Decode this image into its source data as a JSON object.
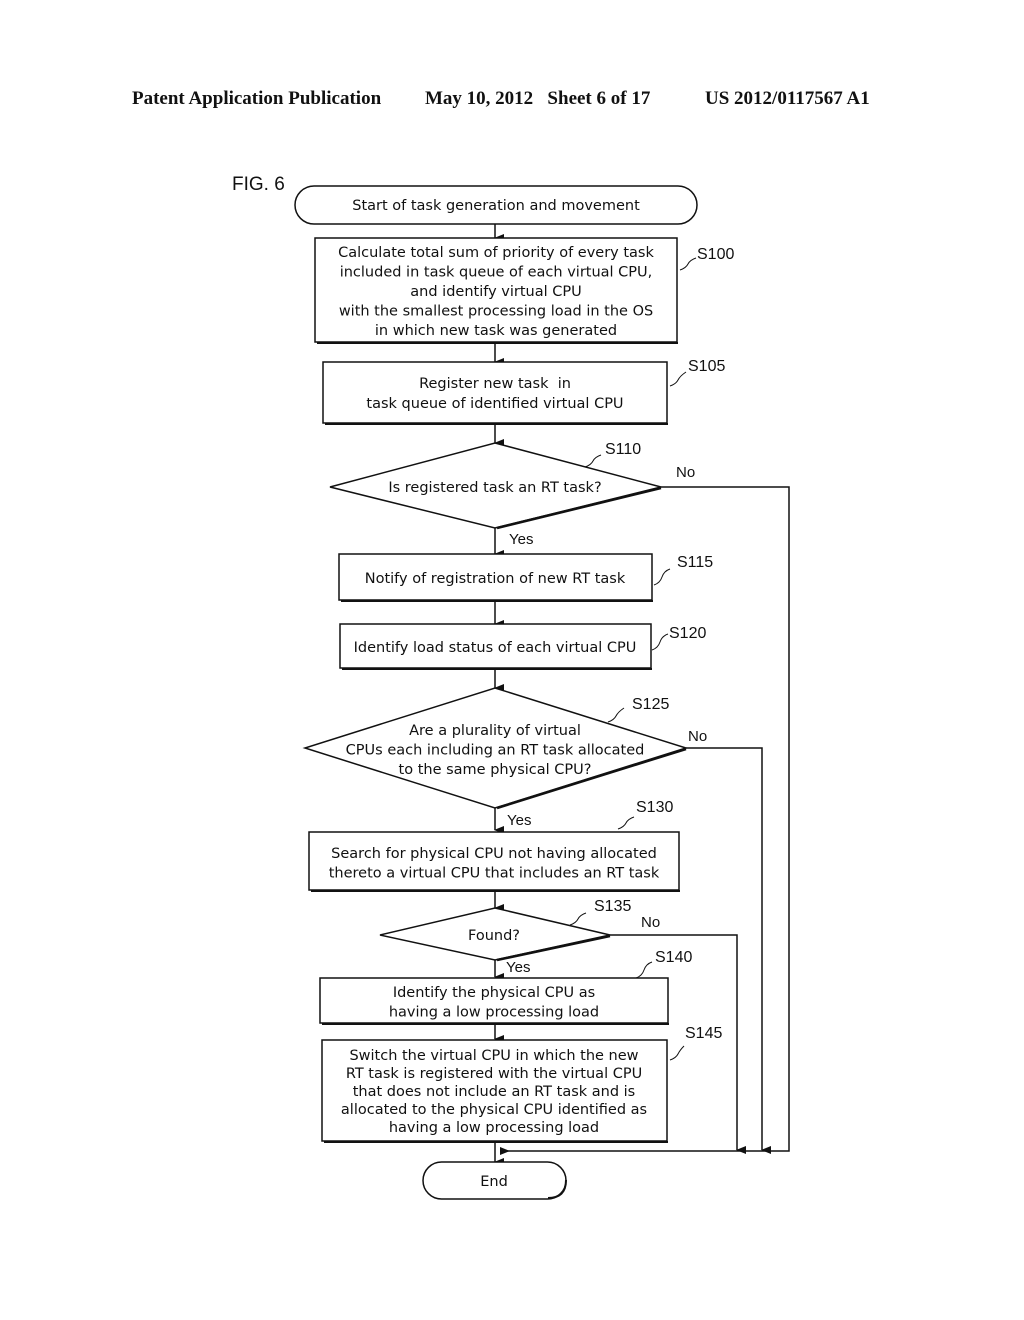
{
  "header": {
    "publication": "Patent Application Publication",
    "date_sheet": "May 10, 2012   Sheet 6 of 17",
    "patent_number": "US 2012/0117567 A1"
  },
  "figure": {
    "label": "FIG. 6",
    "start": "Start of task generation and movement",
    "end": "End",
    "steps": {
      "S100": {
        "id": "S100",
        "lines": [
          "Calculate total sum of priority of every task",
          "included in task queue of each virtual CPU,",
          "and identify virtual CPU",
          "with the smallest processing load in the OS",
          "in which new task was generated"
        ]
      },
      "S105": {
        "id": "S105",
        "lines": [
          "Register new task  in",
          "task queue of identified virtual CPU"
        ]
      },
      "S110": {
        "id": "S110",
        "lines": [
          "Is registered task an RT task?"
        ],
        "yes": "Yes",
        "no": "No"
      },
      "S115": {
        "id": "S115",
        "lines": [
          "Notify of registration of new RT task"
        ]
      },
      "S120": {
        "id": "S120",
        "lines": [
          "Identify load status of each virtual CPU"
        ]
      },
      "S125": {
        "id": "S125",
        "lines": [
          "Are a plurality of virtual",
          "CPUs each including an RT task allocated",
          "to the same physical CPU?"
        ],
        "yes": "Yes",
        "no": "No"
      },
      "S130": {
        "id": "S130",
        "lines": [
          "Search for physical CPU not having allocated",
          "thereto a virtual CPU that includes an RT task"
        ]
      },
      "S135": {
        "id": "S135",
        "lines": [
          "Found?"
        ],
        "yes": "Yes",
        "no": "No"
      },
      "S140": {
        "id": "S140",
        "lines": [
          "Identify the physical CPU as",
          "having a low processing load"
        ]
      },
      "S145": {
        "id": "S145",
        "lines": [
          "Switch the virtual CPU in which the new",
          "RT task is registered with the virtual CPU",
          "that does not include an RT task and is",
          "allocated to the physical CPU identified as",
          "having a low processing load"
        ]
      }
    }
  }
}
